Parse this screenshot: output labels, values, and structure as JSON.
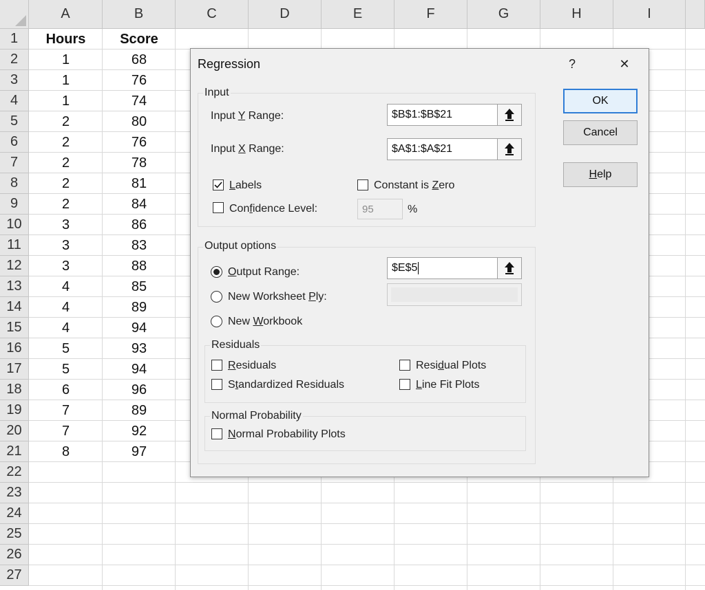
{
  "sheet": {
    "columns": [
      "A",
      "B",
      "C",
      "D",
      "E",
      "F",
      "G",
      "H",
      "I"
    ],
    "rows": [
      "1",
      "2",
      "3",
      "4",
      "5",
      "6",
      "7",
      "8",
      "9",
      "10",
      "11",
      "12",
      "13",
      "14",
      "15",
      "16",
      "17",
      "18",
      "19",
      "20",
      "21",
      "22",
      "23",
      "24",
      "25",
      "26",
      "27"
    ],
    "header_a": "Hours",
    "header_b": "Score",
    "data": [
      [
        "1",
        "68"
      ],
      [
        "1",
        "76"
      ],
      [
        "1",
        "74"
      ],
      [
        "2",
        "80"
      ],
      [
        "2",
        "76"
      ],
      [
        "2",
        "78"
      ],
      [
        "2",
        "81"
      ],
      [
        "2",
        "84"
      ],
      [
        "3",
        "86"
      ],
      [
        "3",
        "83"
      ],
      [
        "3",
        "88"
      ],
      [
        "4",
        "85"
      ],
      [
        "4",
        "89"
      ],
      [
        "4",
        "94"
      ],
      [
        "5",
        "93"
      ],
      [
        "5",
        "94"
      ],
      [
        "6",
        "96"
      ],
      [
        "7",
        "89"
      ],
      [
        "7",
        "92"
      ],
      [
        "8",
        "97"
      ]
    ]
  },
  "dialog": {
    "title": "Regression",
    "help_glyph": "?",
    "close_glyph": "✕",
    "input_group": "Input",
    "input_y_label": "Input Y Range:",
    "input_y_value": "$B$1:$B$21",
    "input_x_label": "Input X Range:",
    "input_x_value": "$A$1:$A$21",
    "labels_label": "Labels",
    "labels_checked": true,
    "constant_zero_label": "Constant is Zero",
    "confidence_label": "Confidence Level:",
    "confidence_value": "95",
    "percent": "%",
    "output_group": "Output options",
    "output_range_label": "Output Range:",
    "output_range_value": "$E$5",
    "new_ply_label": "New Worksheet Ply:",
    "new_workbook_label": "New Workbook",
    "residuals_group": "Residuals",
    "residuals_label": "Residuals",
    "std_residuals_label": "Standardized Residuals",
    "residual_plots_label": "Residual Plots",
    "line_fit_label": "Line Fit Plots",
    "normal_group": "Normal Probability",
    "normal_plots_label": "Normal Probability Plots",
    "ok_label": "OK",
    "cancel_label": "Cancel",
    "help_label": "Help"
  }
}
